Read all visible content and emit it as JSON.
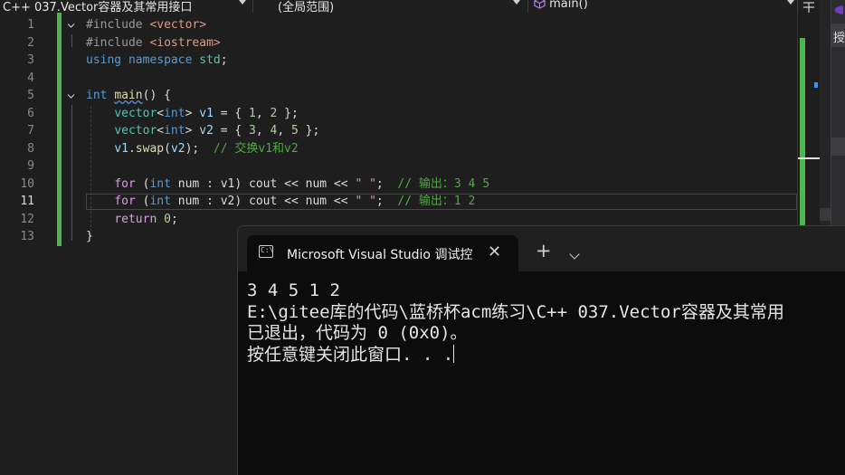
{
  "navbar": {
    "project": "C++ 037.Vector容器及其常用接口",
    "scope": "(全局范围)",
    "member": "main()"
  },
  "editor": {
    "lines": [
      {
        "n": "1",
        "tokens": [
          {
            "t": "#include ",
            "c": "pp"
          },
          {
            "t": "<vector>",
            "c": "inc"
          }
        ]
      },
      {
        "n": "2",
        "tokens": [
          {
            "t": "#include ",
            "c": "pp"
          },
          {
            "t": "<iostream>",
            "c": "inc"
          }
        ]
      },
      {
        "n": "3",
        "tokens": [
          {
            "t": "using ",
            "c": "kw"
          },
          {
            "t": "namespace ",
            "c": "kw"
          },
          {
            "t": "std",
            "c": "ns"
          },
          {
            "t": ";",
            "c": ""
          }
        ]
      },
      {
        "n": "4",
        "tokens": []
      },
      {
        "n": "5",
        "tokens": [
          {
            "t": "int ",
            "c": "kw"
          },
          {
            "t": "main",
            "c": "fn"
          },
          {
            "t": "() {",
            "c": ""
          }
        ]
      },
      {
        "n": "6",
        "tokens": [
          {
            "t": "    "
          },
          {
            "t": "vector",
            "c": "tp"
          },
          {
            "t": "<",
            "c": ""
          },
          {
            "t": "int",
            "c": "kw"
          },
          {
            "t": "> ",
            "c": ""
          },
          {
            "t": "v1",
            "c": "var"
          },
          {
            "t": " = { ",
            "c": ""
          },
          {
            "t": "1",
            "c": "num"
          },
          {
            "t": ", ",
            "c": ""
          },
          {
            "t": "2",
            "c": "num"
          },
          {
            "t": " };",
            "c": ""
          }
        ]
      },
      {
        "n": "7",
        "tokens": [
          {
            "t": "    "
          },
          {
            "t": "vector",
            "c": "tp"
          },
          {
            "t": "<",
            "c": ""
          },
          {
            "t": "int",
            "c": "kw"
          },
          {
            "t": "> ",
            "c": ""
          },
          {
            "t": "v2",
            "c": "var"
          },
          {
            "t": " = { ",
            "c": ""
          },
          {
            "t": "3",
            "c": "num"
          },
          {
            "t": ", ",
            "c": ""
          },
          {
            "t": "4",
            "c": "num"
          },
          {
            "t": ", ",
            "c": ""
          },
          {
            "t": "5",
            "c": "num"
          },
          {
            "t": " };",
            "c": ""
          }
        ]
      },
      {
        "n": "8",
        "tokens": [
          {
            "t": "    "
          },
          {
            "t": "v1",
            "c": "var"
          },
          {
            "t": ".",
            "c": ""
          },
          {
            "t": "swap",
            "c": "fn"
          },
          {
            "t": "(",
            "c": ""
          },
          {
            "t": "v2",
            "c": "var"
          },
          {
            "t": ");  ",
            "c": ""
          },
          {
            "t": "// 交换v1和v2",
            "c": "cmt"
          }
        ]
      },
      {
        "n": "9",
        "tokens": []
      },
      {
        "n": "10",
        "tokens": [
          {
            "t": "    "
          },
          {
            "t": "for",
            "c": "ctl"
          },
          {
            "t": " (",
            "c": ""
          },
          {
            "t": "int",
            "c": "kw"
          },
          {
            "t": " num : v1) cout << num << ",
            "c": ""
          },
          {
            "t": "\" \"",
            "c": "str"
          },
          {
            "t": ";  ",
            "c": ""
          },
          {
            "t": "// 输出：3 4 5",
            "c": "cmt"
          }
        ]
      },
      {
        "n": "11",
        "tokens": [
          {
            "t": "    "
          },
          {
            "t": "for",
            "c": "ctl"
          },
          {
            "t": " (",
            "c": ""
          },
          {
            "t": "int",
            "c": "kw"
          },
          {
            "t": " num : v2) cout << num << ",
            "c": ""
          },
          {
            "t": "\" \"",
            "c": "str"
          },
          {
            "t": ";  ",
            "c": ""
          },
          {
            "t": "// 输出：1 2",
            "c": "cmt"
          }
        ]
      },
      {
        "n": "12",
        "tokens": [
          {
            "t": "    "
          },
          {
            "t": "return",
            "c": "ctl"
          },
          {
            "t": " ",
            "c": ""
          },
          {
            "t": "0",
            "c": "num"
          },
          {
            "t": ";",
            "c": ""
          }
        ]
      },
      {
        "n": "13",
        "tokens": [
          {
            "t": "}",
            "c": ""
          }
        ]
      }
    ]
  },
  "terminal": {
    "tab_title": "Microsoft Visual Studio 调试控",
    "icon_text": "C:\\",
    "close_label": "✕",
    "add_label": "+",
    "output": [
      "3 4 5 1 2",
      "E:\\gitee库的代码\\蓝桥杯acm练习\\C++ 037.Vector容器及其常用",
      "已退出，代码为 0 (0x0)。",
      "按任意键关闭此窗口. . ."
    ]
  },
  "sidebar": {
    "label": "授"
  }
}
